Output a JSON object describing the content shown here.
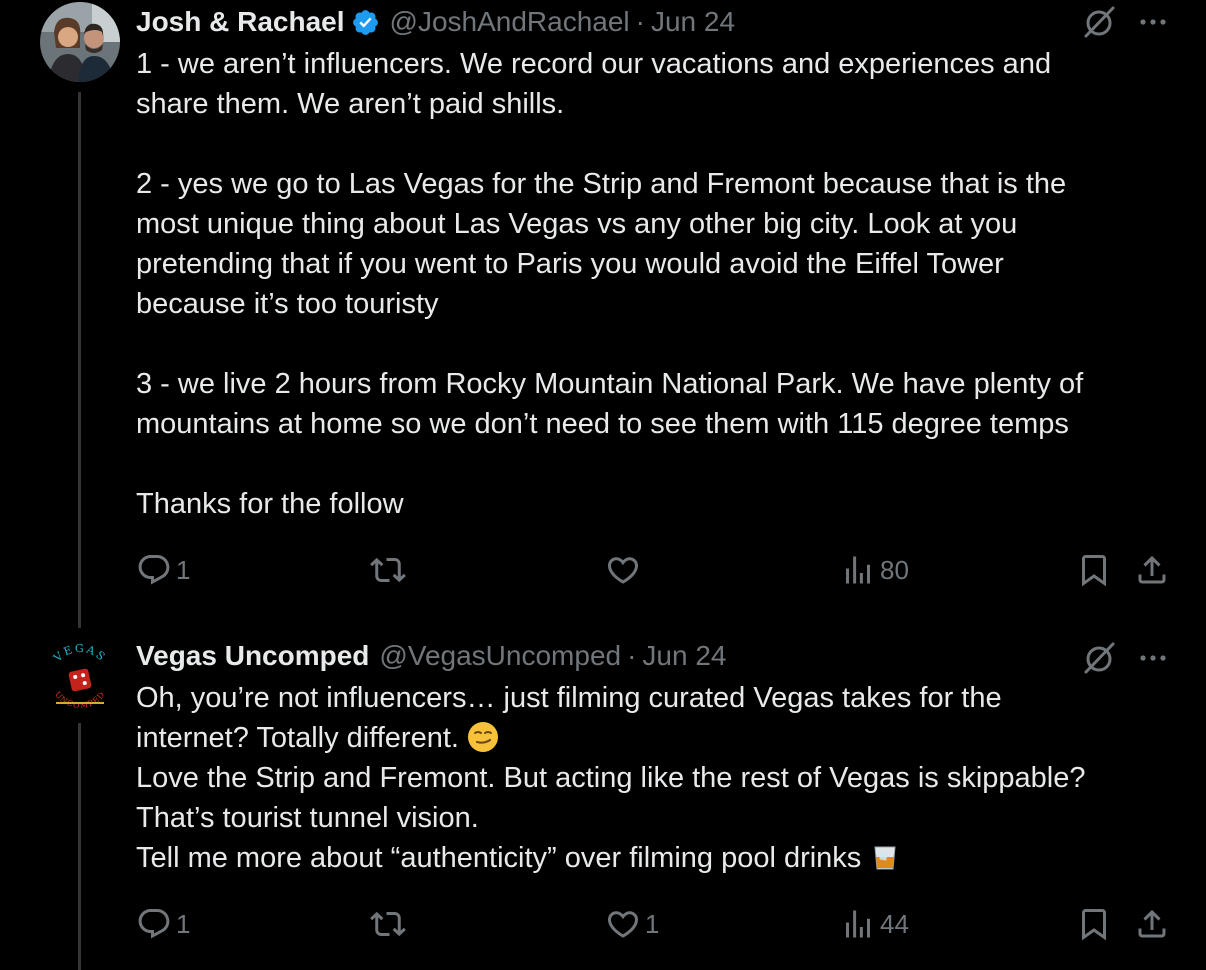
{
  "posts": [
    {
      "author_name": "Josh & Rachael",
      "handle": "@JoshAndRachael",
      "separator": "·",
      "date": "Jun 24",
      "verified": true,
      "text": "1 - we aren’t influencers. We record our vacations and experiences and\nshare them. We aren’t paid shills.\n\n2 - yes we go to Las Vegas for the Strip and Fremont because that is the\nmost unique thing about Las Vegas vs any other big city. Look at you\npretending that if you went to Paris you would avoid the Eiffel Tower\nbecause it’s too touristy\n\n3 - we live 2 hours from Rocky Mountain National Park. We have plenty of\nmountains at home so we don’t need to see them with 115 degree temps\n\nThanks for the follow",
      "replies": "1",
      "reposts": "",
      "likes": "",
      "views": "80"
    },
    {
      "author_name": "Vegas Uncomped",
      "handle": "@VegasUncomped",
      "separator": "·",
      "date": "Jun 24",
      "verified": false,
      "avatar_text_top": "VEGAS",
      "avatar_text_bottom": "UNCOMPED",
      "text_line1": "Oh, you’re not influencers… just filming curated Vegas takes for the",
      "text_line2": "internet? Totally different. ",
      "text_rest": "Love the Strip and Fremont. But acting like the rest of Vegas is skippable?\nThat’s tourist tunnel vision.\nTell me more about “authenticity” over filming pool drinks ",
      "replies": "1",
      "reposts": "",
      "likes": "1",
      "views": "44"
    }
  ],
  "icons": {
    "reply": "reply-icon",
    "repost": "repost-icon",
    "like": "heart-icon",
    "views": "views-icon",
    "bookmark": "bookmark-icon",
    "share": "share-icon",
    "grok": "grok-icon",
    "more": "more-icon"
  },
  "colors": {
    "background": "#000000",
    "text": "#e7e9ea",
    "muted": "#71767b",
    "verified": "#1d9bf0",
    "thread_line": "#333639"
  }
}
